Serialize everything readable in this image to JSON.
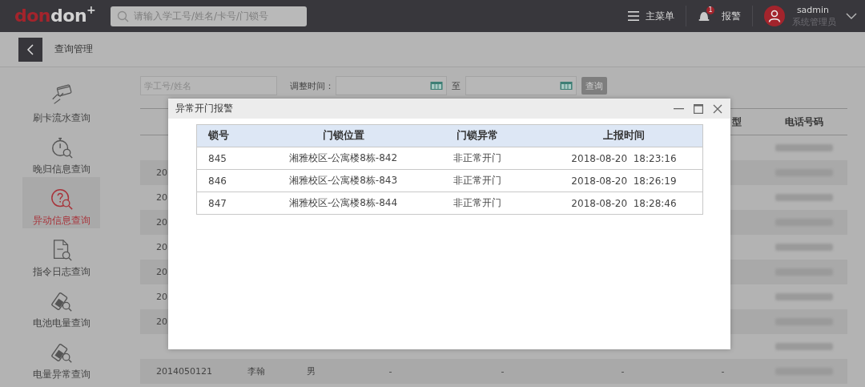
{
  "top_bar": {
    "logo": [
      {
        "text": "don",
        "color": "#a3242c"
      },
      {
        "text": "don",
        "color": "#d2d2d2"
      },
      {
        "text": "+",
        "color": "#d2d2d2"
      }
    ],
    "search": {
      "placeholder": "请输入学工号/姓名/卡号/门锁号"
    },
    "menu_label": "主菜单",
    "alarm": {
      "label": "报警",
      "badge": "1"
    },
    "user": {
      "name": "sadmin",
      "role": "系统管理员"
    }
  },
  "breadcrumb": {
    "title": "查询管理"
  },
  "sidebar": {
    "items": [
      {
        "label": "刷卡流水查询",
        "selected": false
      },
      {
        "label": "晚归信息查询",
        "selected": false
      },
      {
        "label": "异动信息查询",
        "selected": true
      },
      {
        "label": "指令日志查询",
        "selected": false
      },
      {
        "label": "电池电量查询",
        "selected": false
      },
      {
        "label": "电量异常查询",
        "selected": false
      }
    ]
  },
  "filters": {
    "keyword": {
      "placeholder": "学工号/姓名"
    },
    "time_label": "调整时间：",
    "to_label": "至",
    "query_button": "查询"
  },
  "table": {
    "header": {
      "column_7": "型",
      "phone": "电话号码"
    },
    "rows": [
      {
        "cells": [],
        "phone_blurred": true
      },
      {
        "cells": [
          "20"
        ],
        "phone_blurred": true
      },
      {
        "cells": [
          "20"
        ],
        "phone_blurred": true
      },
      {
        "cells": [
          "20"
        ],
        "phone_blurred": true
      },
      {
        "cells": [
          "20"
        ],
        "phone_blurred": true
      },
      {
        "cells": [
          "20"
        ],
        "phone_blurred": true
      },
      {
        "cells": [
          "20"
        ],
        "phone_blurred": true
      },
      {
        "cells": [
          "20"
        ],
        "phone_blurred": true
      },
      {
        "cells": [],
        "phone_blurred": true
      },
      {
        "cells": [
          "2014050121",
          "李翰",
          "男",
          "-",
          "-",
          "-",
          "-"
        ],
        "phone_blurred": true
      }
    ]
  },
  "dialog": {
    "title": "异常开门报警",
    "columns": [
      "锁号",
      "门锁位置",
      "门锁异常",
      "上报时间"
    ],
    "rows": [
      [
        "845",
        "湘雅校区-公寓楼8栋-842",
        "非正常开门",
        "2018-08-20  18:23:16"
      ],
      [
        "846",
        "湘雅校区-公寓楼8栋-843",
        "非正常开门",
        "2018-08-20  18:26:19"
      ],
      [
        "847",
        "湘雅校区-公寓楼8栋-844",
        "非正常开门",
        "2018-08-20  18:28:46"
      ]
    ]
  }
}
